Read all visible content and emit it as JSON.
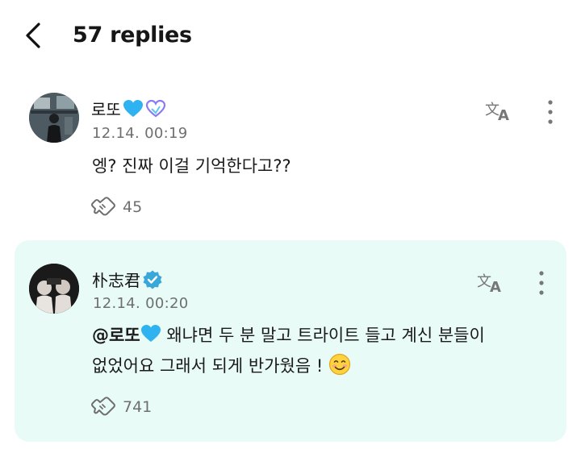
{
  "header": {
    "title": "57 replies"
  },
  "comments": [
    {
      "author": "로또",
      "badges": [
        "blue-heart-icon",
        "purple-heart-outline-icon"
      ],
      "timestamp": "12.14. 00:19",
      "text": "엥? 진짜 이걸 기억한다고??",
      "like_count": "45",
      "highlighted": false
    },
    {
      "author": "朴志君",
      "badges": [
        "verified-badge-icon"
      ],
      "timestamp": "12.14. 00:20",
      "mention": "@로또",
      "text_line1": "왜냐면 두 분 말고 트라이트 들고 계신 분들이",
      "text_line2": "없었어요 그래서 되게 반가웠음 !",
      "like_count": "741",
      "highlighted": true
    }
  ],
  "colors": {
    "highlight_bg": "#e8fbf7",
    "verified": "#3aa7d9",
    "heart_blue": "#2fb3f0",
    "muted_text": "#6f6f6f"
  }
}
